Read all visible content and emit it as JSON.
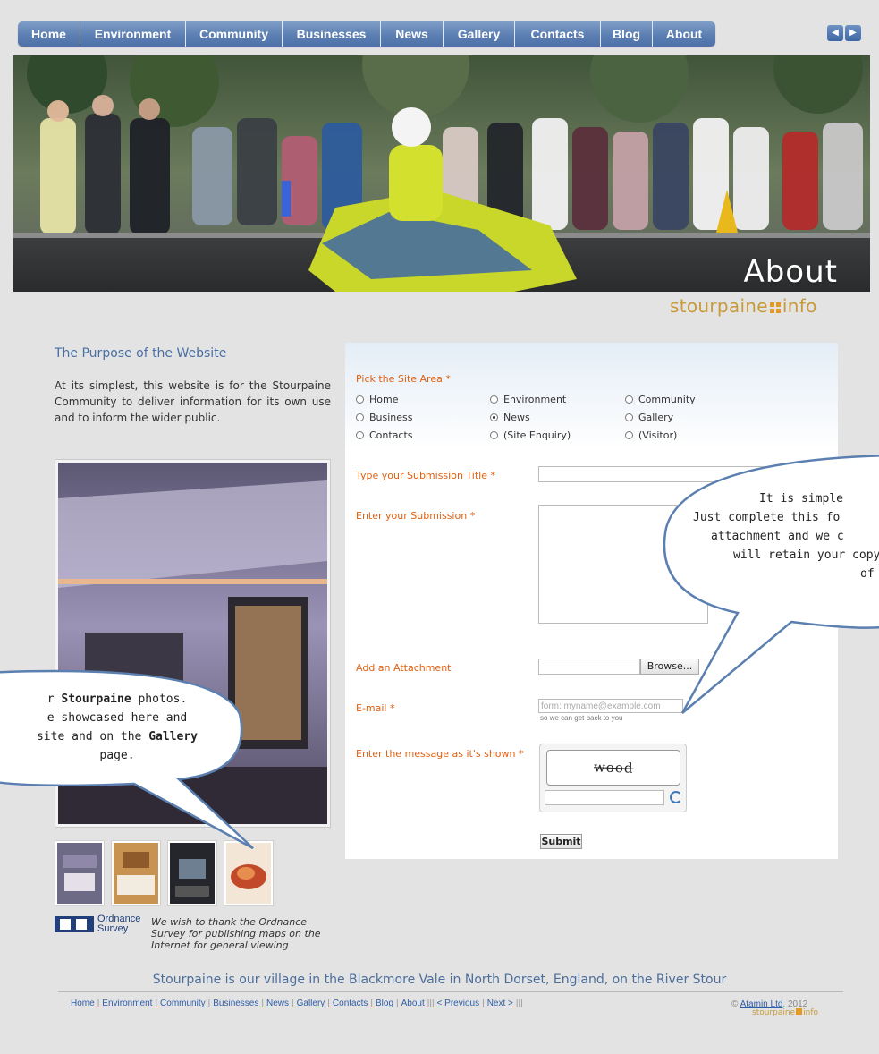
{
  "nav": {
    "items": [
      "Home",
      "Environment",
      "Community",
      "Businesses",
      "News",
      "Gallery",
      "Contacts",
      "Blog",
      "About"
    ],
    "prev_icon": "triangle-left-icon",
    "next_icon": "triangle-right-icon"
  },
  "hero": {
    "title": "About",
    "brand_left": "stourpaine",
    "brand_right": "info"
  },
  "purpose": {
    "title": "The Purpose of the Website",
    "text": "At its simplest, this website is for the Stourpaine Community to deliver information for its own use and to inform the wider public."
  },
  "os": {
    "brand_line1": "Ordnance",
    "brand_line2": "Survey",
    "thanks": "We wish to thank the Ordnance Survey for publishing maps on the Internet for general viewing"
  },
  "form": {
    "site_area_label": "Pick the Site Area",
    "required_mark": "*",
    "areas": [
      {
        "label": "Home",
        "selected": false
      },
      {
        "label": "Environment",
        "selected": false
      },
      {
        "label": "Community",
        "selected": false
      },
      {
        "label": "Business",
        "selected": false
      },
      {
        "label": "News",
        "selected": true
      },
      {
        "label": "Gallery",
        "selected": false
      },
      {
        "label": "Contacts",
        "selected": false
      },
      {
        "label": "(Site Enquiry)",
        "selected": false
      },
      {
        "label": "(Visitor)",
        "selected": false
      }
    ],
    "title_label": "Type your Submission Title",
    "submission_label": "Enter your Submission",
    "attachment_label": "Add an Attachment",
    "browse_label": "Browse...",
    "email_label": "E-mail",
    "email_placeholder": "form: myname@example.com",
    "email_hint": "so we can get back to you",
    "captcha_label": "Enter the message as it's shown",
    "captcha_text": "wood",
    "submit_label": "Submit"
  },
  "bubbles": {
    "left": {
      "line1_a": "r ",
      "line1_b": "Stourpaine",
      "line1_c": " photos.",
      "line2": "e showcased here and",
      "line3_a": "site and on the ",
      "line3_b": "Gallery",
      "line4": "page."
    },
    "right": {
      "line1": "It is simple",
      "line2": "Just complete this fo",
      "line3": "attachment and we c",
      "line4": "will retain your copy",
      "line5": "of"
    }
  },
  "footer": {
    "tagline": "Stourpaine is our village in the Blackmore Vale in North Dorset, England, on the River Stour",
    "links": [
      "Home",
      "Environment",
      "Community",
      "Businesses",
      "News",
      "Gallery",
      "Contacts",
      "Blog",
      "About"
    ],
    "triple_sep": "|||",
    "prev": "< Previous",
    "next": "Next >",
    "copyright_symbol": "©",
    "company": "Atamin Ltd",
    "year": ", 2012",
    "brand_left": "stourpaine",
    "brand_right": "info"
  }
}
